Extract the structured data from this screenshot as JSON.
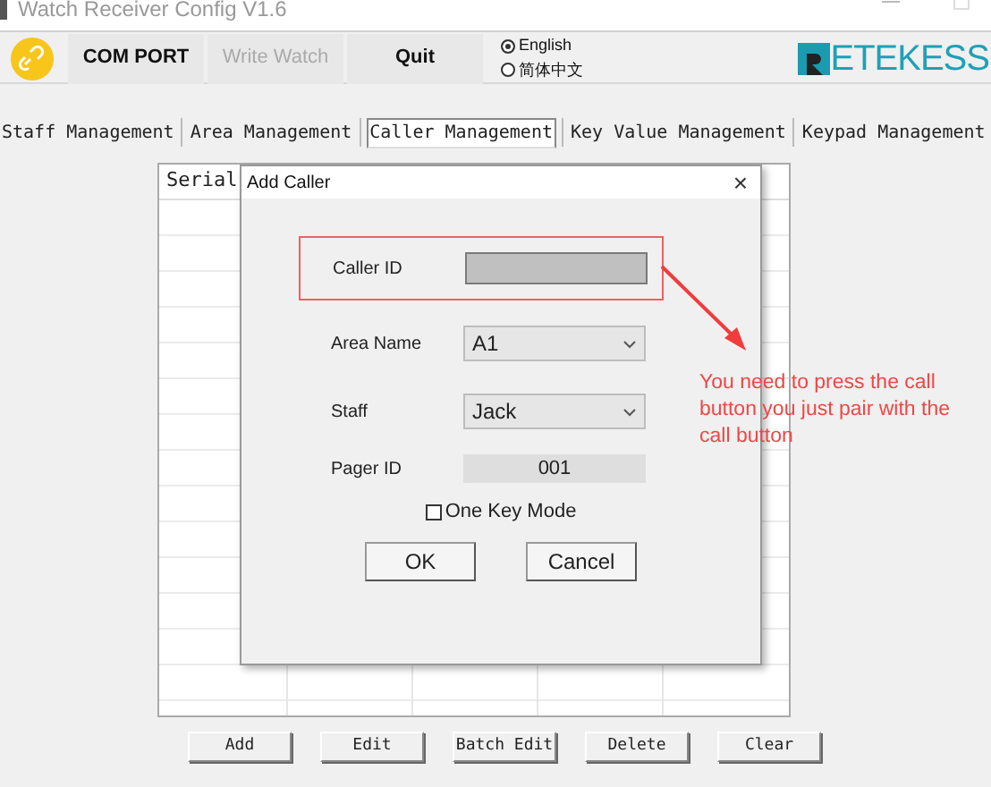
{
  "window": {
    "title": "Watch Receiver Config V1.6"
  },
  "toolbar": {
    "buttons": [
      {
        "label": "COM PORT",
        "disabled": false
      },
      {
        "label": "Write Watch",
        "disabled": true
      },
      {
        "label": "Quit",
        "disabled": false
      }
    ],
    "languages": [
      {
        "label": "English",
        "selected": true
      },
      {
        "label": "简体中文",
        "selected": false
      }
    ],
    "brand": "ETEKESS"
  },
  "tabs": [
    {
      "label": "Staff Management",
      "selected": false
    },
    {
      "label": "Area Management",
      "selected": false
    },
    {
      "label": "Caller Management",
      "selected": true
    },
    {
      "label": "Key Value Management",
      "selected": false
    },
    {
      "label": "Keypad Management",
      "selected": false
    }
  ],
  "table": {
    "columns": [
      "Serial"
    ]
  },
  "dialog": {
    "title": "Add Caller",
    "close": "×",
    "fields": [
      {
        "kind": "input",
        "label": "Caller ID",
        "highlighted": true
      },
      {
        "kind": "select",
        "label": "Area Name",
        "value": "A1",
        "highlighted": false
      },
      {
        "kind": "select",
        "label": "Staff",
        "value": "Jack",
        "highlighted": false
      },
      {
        "kind": "readonly",
        "label": "Pager ID",
        "value": "001",
        "highlighted": false
      }
    ],
    "checkbox": {
      "label": "One Key Mode",
      "checked": false
    },
    "buttons": [
      "OK",
      "Cancel"
    ]
  },
  "annotation": "You need to press the call button you just pair with the call button",
  "actions": [
    "Add",
    "Edit",
    "Batch Edit",
    "Delete",
    "Clear"
  ]
}
